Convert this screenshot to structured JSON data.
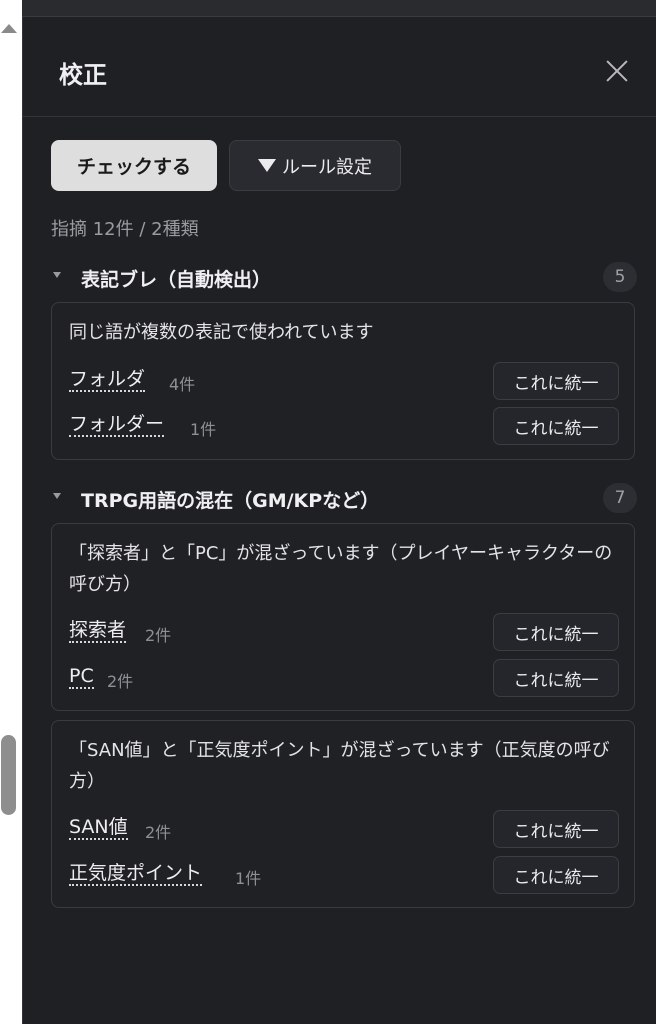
{
  "panel": {
    "title": "校正"
  },
  "toolbar": {
    "check_label": "チェックする",
    "rules_label": "ルール設定"
  },
  "summary": "指摘 12件 / 2種類",
  "sections": [
    {
      "title": "表記ブレ（自動検出）",
      "count": "5",
      "cards": [
        {
          "description": "同じ語が複数の表記で使われています",
          "terms": [
            {
              "term": "フォルダ",
              "count": "4件",
              "action": "これに統一"
            },
            {
              "term": "フォルダー",
              "count": "1件",
              "action": "これに統一"
            }
          ]
        }
      ]
    },
    {
      "title": "TRPG用語の混在（GM/KPなど）",
      "count": "7",
      "cards": [
        {
          "description": "「探索者」と「PC」が混ざっています（プレイヤーキャラクターの呼び方）",
          "terms": [
            {
              "term": "探索者",
              "count": "2件",
              "action": "これに統一"
            },
            {
              "term": "PC",
              "count": "2件",
              "action": "これに統一"
            }
          ]
        },
        {
          "description": "「SAN値」と「正気度ポイント」が混ざっています（正気度の呼び方）",
          "terms": [
            {
              "term": "SAN値",
              "count": "2件",
              "action": "これに統一"
            },
            {
              "term": "正気度ポイント",
              "count": "1件",
              "action": "これに統一"
            }
          ]
        }
      ]
    }
  ],
  "icons": {
    "close": "close-icon",
    "rules_toggle": "triangle-down-icon",
    "section_caret": "caret-down-icon"
  },
  "colors": {
    "background": "#1f2024",
    "primary_button": "#dedede",
    "text": "#e6e6e8",
    "muted": "#9a9ba1"
  }
}
